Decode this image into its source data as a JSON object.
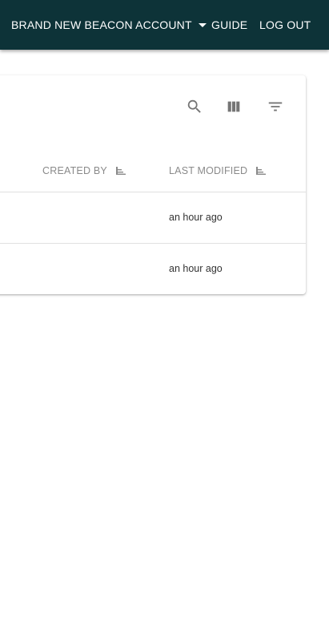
{
  "appbar": {
    "account_label": "BRAND NEW BEACON ACCOUNT",
    "guide_label": "GUIDE",
    "logout_label": "LOG OUT",
    "background": "#0d3338"
  },
  "toolbar": {
    "icons": [
      "search-icon",
      "view-columns-icon",
      "filter-icon"
    ]
  },
  "table": {
    "columns": [
      "CREATED BY",
      "LAST MODIFIED"
    ],
    "rows": [
      {
        "created_by": "",
        "last_modified": "an hour ago"
      },
      {
        "created_by": "",
        "last_modified": "an hour ago"
      }
    ]
  }
}
